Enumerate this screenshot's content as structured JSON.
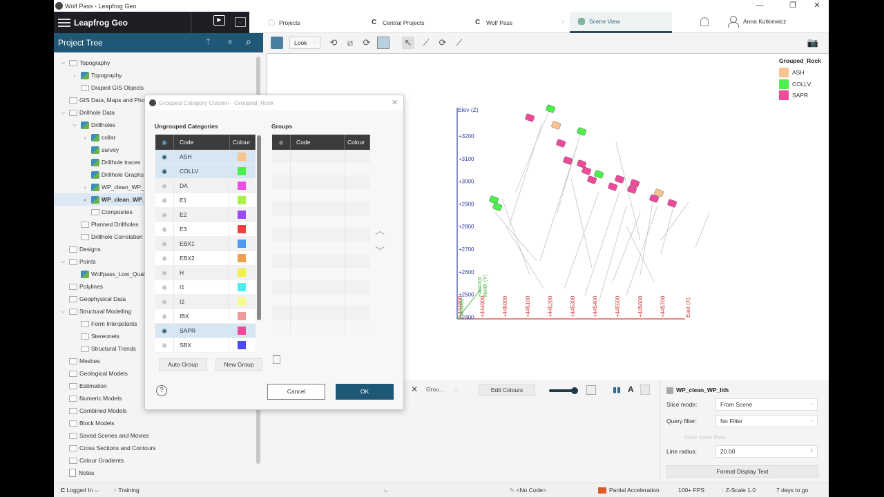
{
  "window": {
    "title": "Wolf Pass - Leapfrog Geo",
    "minimize": "—",
    "restore": "❐",
    "close": "✕"
  },
  "topbar": {
    "brand": "Leapfrog Geo",
    "tabs": [
      {
        "label": "Projects",
        "icon": "projects-icon"
      },
      {
        "label": "Central Projects",
        "icon": "central-icon"
      },
      {
        "label": "Wolf Pass",
        "icon": "central-icon"
      },
      {
        "label": "Scene View",
        "icon": "scene-icon",
        "active": true
      }
    ],
    "user": "Anna Kutkiewicz"
  },
  "project_tree": {
    "title": "Project Tree",
    "items": [
      {
        "label": "Topography",
        "level": 0,
        "expanded": true,
        "type": "folder"
      },
      {
        "label": "Topography",
        "level": 1,
        "collapsed": true,
        "type": "data"
      },
      {
        "label": "Draped GIS Objects",
        "level": 1,
        "type": "folder"
      },
      {
        "label": "GIS Data, Maps and Photos",
        "level": 0,
        "type": "folder"
      },
      {
        "label": "Drillhole Data",
        "level": 0,
        "expanded": true,
        "type": "folder"
      },
      {
        "label": "Drillholes",
        "level": 1,
        "expanded": true,
        "type": "data"
      },
      {
        "label": "collar",
        "level": 2,
        "collapsed": true,
        "type": "data"
      },
      {
        "label": "survey",
        "level": 2,
        "type": "data"
      },
      {
        "label": "Drillhole traces",
        "level": 2,
        "type": "data"
      },
      {
        "label": "Drillhole Graphs",
        "level": 2,
        "type": "data"
      },
      {
        "label": "WP_clean_WP_assay",
        "level": 2,
        "collapsed": true,
        "type": "data"
      },
      {
        "label": "WP_clean_WP_lith",
        "level": 2,
        "collapsed": true,
        "type": "data",
        "selected": true
      },
      {
        "label": "Composites",
        "level": 2,
        "type": "folder"
      },
      {
        "label": "Planned Drillholes",
        "level": 1,
        "type": "folder"
      },
      {
        "label": "Drillhole Correlation",
        "level": 1,
        "type": "folder"
      },
      {
        "label": "Designs",
        "level": 0,
        "type": "folder"
      },
      {
        "label": "Points",
        "level": 0,
        "expanded": true,
        "type": "folder"
      },
      {
        "label": "Wolfpass_Low_Quality",
        "level": 1,
        "type": "data"
      },
      {
        "label": "Polylines",
        "level": 0,
        "type": "folder"
      },
      {
        "label": "Geophysical Data",
        "level": 0,
        "type": "folder"
      },
      {
        "label": "Structural Modelling",
        "level": 0,
        "expanded": true,
        "type": "folder"
      },
      {
        "label": "Form Interpolants",
        "level": 1,
        "type": "folder"
      },
      {
        "label": "Stereonets",
        "level": 1,
        "type": "folder"
      },
      {
        "label": "Structural Trends",
        "level": 1,
        "type": "folder"
      },
      {
        "label": "Meshes",
        "level": 0,
        "type": "folder"
      },
      {
        "label": "Geological Models",
        "level": 0,
        "type": "folder"
      },
      {
        "label": "Estimation",
        "level": 0,
        "type": "folder"
      },
      {
        "label": "Numeric Models",
        "level": 0,
        "type": "folder"
      },
      {
        "label": "Combined Models",
        "level": 0,
        "type": "folder"
      },
      {
        "label": "Block Models",
        "level": 0,
        "type": "folder"
      },
      {
        "label": "Saved Scenes and Movies",
        "level": 0,
        "type": "folder"
      },
      {
        "label": "Cross Sections and Contours",
        "level": 0,
        "type": "folder"
      },
      {
        "label": "Colour Gradients",
        "level": 0,
        "type": "folder"
      },
      {
        "label": "Notes",
        "level": 0,
        "type": "note"
      }
    ]
  },
  "viewer": {
    "look_label": "Look",
    "legend": {
      "title": "Grouped_Rock",
      "items": [
        {
          "label": "ASH",
          "color": "#f9c38f"
        },
        {
          "label": "COLLV",
          "color": "#4cf04c"
        },
        {
          "label": "SAPR",
          "color": "#f04a9a"
        }
      ]
    },
    "axes": {
      "z_label": "Elev (Z)",
      "z_ticks": [
        "+3200",
        "+3100",
        "+3000",
        "+2900",
        "+2800",
        "+2700",
        "+2600",
        "+2500",
        "+2400"
      ],
      "x_label": "East (X)",
      "x_ticks": [
        "+444800",
        "+444900",
        "+445000",
        "+445100",
        "+445200",
        "+445300",
        "+445400",
        "+445500",
        "+445600",
        "+445700"
      ],
      "y_label": "North (Y)",
      "y_ticks": [
        "+494000",
        "+493000"
      ]
    }
  },
  "bottom_toolbar": {
    "column_select": "Grou...",
    "edit_colours": "Edit Colours",
    "opacity_value": 1.0
  },
  "properties": {
    "object": "WP_clean_WP_lith",
    "slice_mode_label": "Slice mode:",
    "slice_mode_value": "From Scene",
    "query_filter_label": "Query filter:",
    "query_filter_value": "No Filter",
    "filter_trace_lines": "Filter trace lines",
    "line_radius_label": "Line radius:",
    "line_radius_value": "20.00",
    "format_button": "Format Display Text"
  },
  "status": {
    "logged_in": "Logged In",
    "branch": "Training",
    "code": "<No Code>",
    "acceleration": "Partial Acceleration",
    "fps": "100+ FPS",
    "zscale": "Z-Scale 1.0",
    "trial": "7 days to go"
  },
  "dialog": {
    "title": "Grouped Category Column - Grouped_Rock",
    "ungrouped_label": "Ungrouped Categories",
    "groups_label": "Groups",
    "col_code": "Code",
    "col_colour": "Colour",
    "categories": [
      {
        "code": "ASH",
        "color": "#f9c38f",
        "visible": true
      },
      {
        "code": "COLLV",
        "color": "#4cf04c",
        "visible": true
      },
      {
        "code": "DA",
        "color": "#f04ae8",
        "visible": false
      },
      {
        "code": "E1",
        "color": "#a8f04a",
        "visible": false
      },
      {
        "code": "E2",
        "color": "#9a4af0",
        "visible": false
      },
      {
        "code": "E3",
        "color": "#f04040",
        "visible": false
      },
      {
        "code": "EBX1",
        "color": "#4a9af0",
        "visible": false
      },
      {
        "code": "EBX2",
        "color": "#f0a04a",
        "visible": false
      },
      {
        "code": "H",
        "color": "#f0f04a",
        "visible": false
      },
      {
        "code": "I1",
        "color": "#4af0f0",
        "visible": false
      },
      {
        "code": "I2",
        "color": "#f8f890",
        "visible": false
      },
      {
        "code": "IBX",
        "color": "#f09a9a",
        "visible": false
      },
      {
        "code": "SAPR",
        "color": "#f04a9a",
        "visible": true
      },
      {
        "code": "SBX",
        "color": "#4a4af0",
        "visible": false
      }
    ],
    "auto_group": "Auto Group",
    "new_group": "New Group",
    "cancel": "Cancel",
    "ok": "OK",
    "help": "?"
  }
}
